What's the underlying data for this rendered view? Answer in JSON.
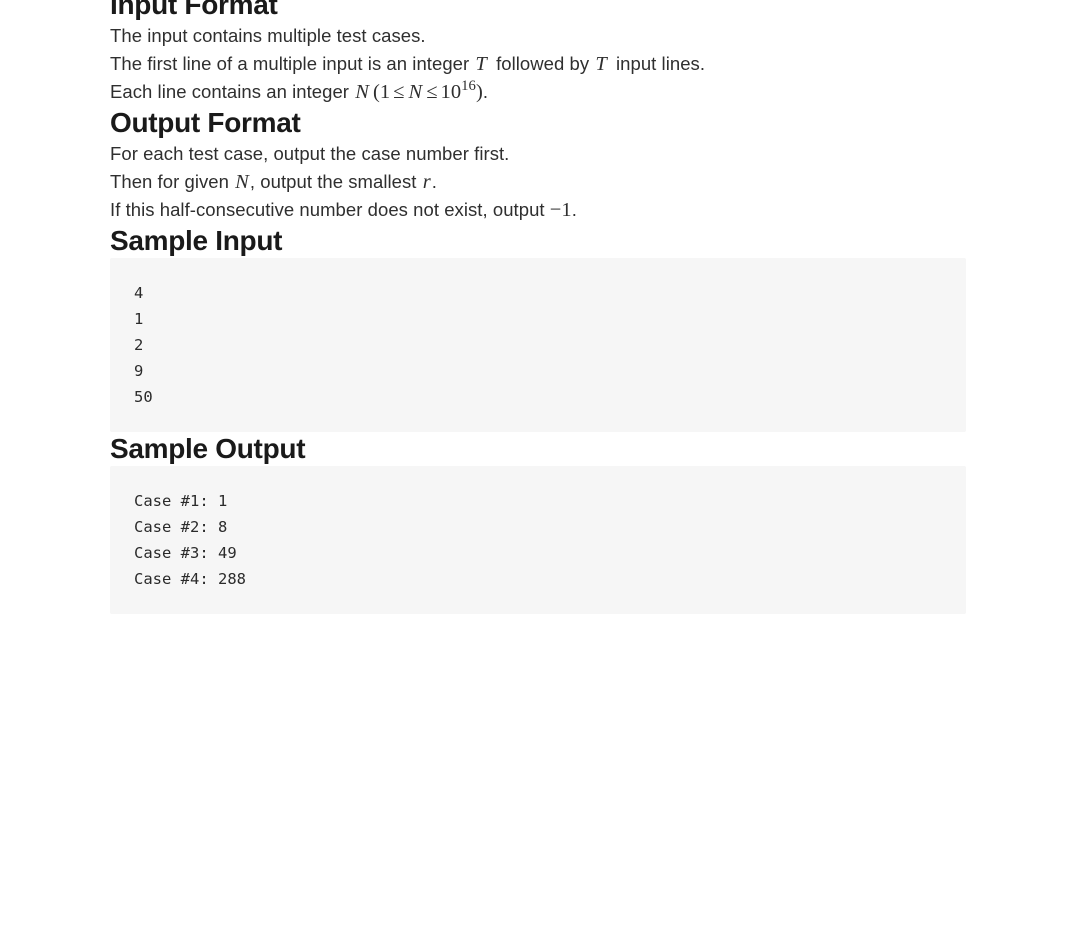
{
  "document": {
    "sections": [
      {
        "id": "input-format",
        "heading": "Input Format",
        "paragraphs": [
          {
            "id": "input-p1",
            "text": "The input contains multiple test cases."
          },
          {
            "id": "input-p2",
            "prefix": "The first line of a multiple input is an integer ",
            "math1": "T",
            "middle": " followed by ",
            "math2": "T",
            "suffix": " input lines."
          },
          {
            "id": "input-p3",
            "prefix": "Each line contains an integer ",
            "math1": "N",
            "constraint": {
              "open": "(",
              "lower": "1",
              "op1": "≤",
              "var": "N",
              "op2": "≤",
              "base": "10",
              "exponent": "16",
              "close": ")"
            },
            "suffix": "."
          }
        ]
      },
      {
        "id": "output-format",
        "heading": "Output Format",
        "paragraphs": [
          {
            "id": "output-p1",
            "text": "For each test case, output the case number first."
          },
          {
            "id": "output-p2",
            "prefix": "Then for given ",
            "math1": "N",
            "middle": ", output the smallest ",
            "math2": "r",
            "suffix": "."
          },
          {
            "id": "output-p3",
            "prefix": "If this half-consecutive number does not exist, output ",
            "math1": "−1",
            "suffix": "."
          }
        ]
      },
      {
        "id": "sample-input",
        "heading": "Sample Input",
        "code": "4\n1\n2\n9\n50"
      },
      {
        "id": "sample-output",
        "heading": "Sample Output",
        "code": "Case #1: 1\nCase #2: 8\nCase #3: 49\nCase #4: 288"
      }
    ]
  },
  "style": {
    "page_background": "#ffffff",
    "heading_color": "#1a1a1a",
    "body_text_color": "#2f2f2f",
    "code_background": "#f6f6f6",
    "code_text_color": "#2b2b2b"
  }
}
